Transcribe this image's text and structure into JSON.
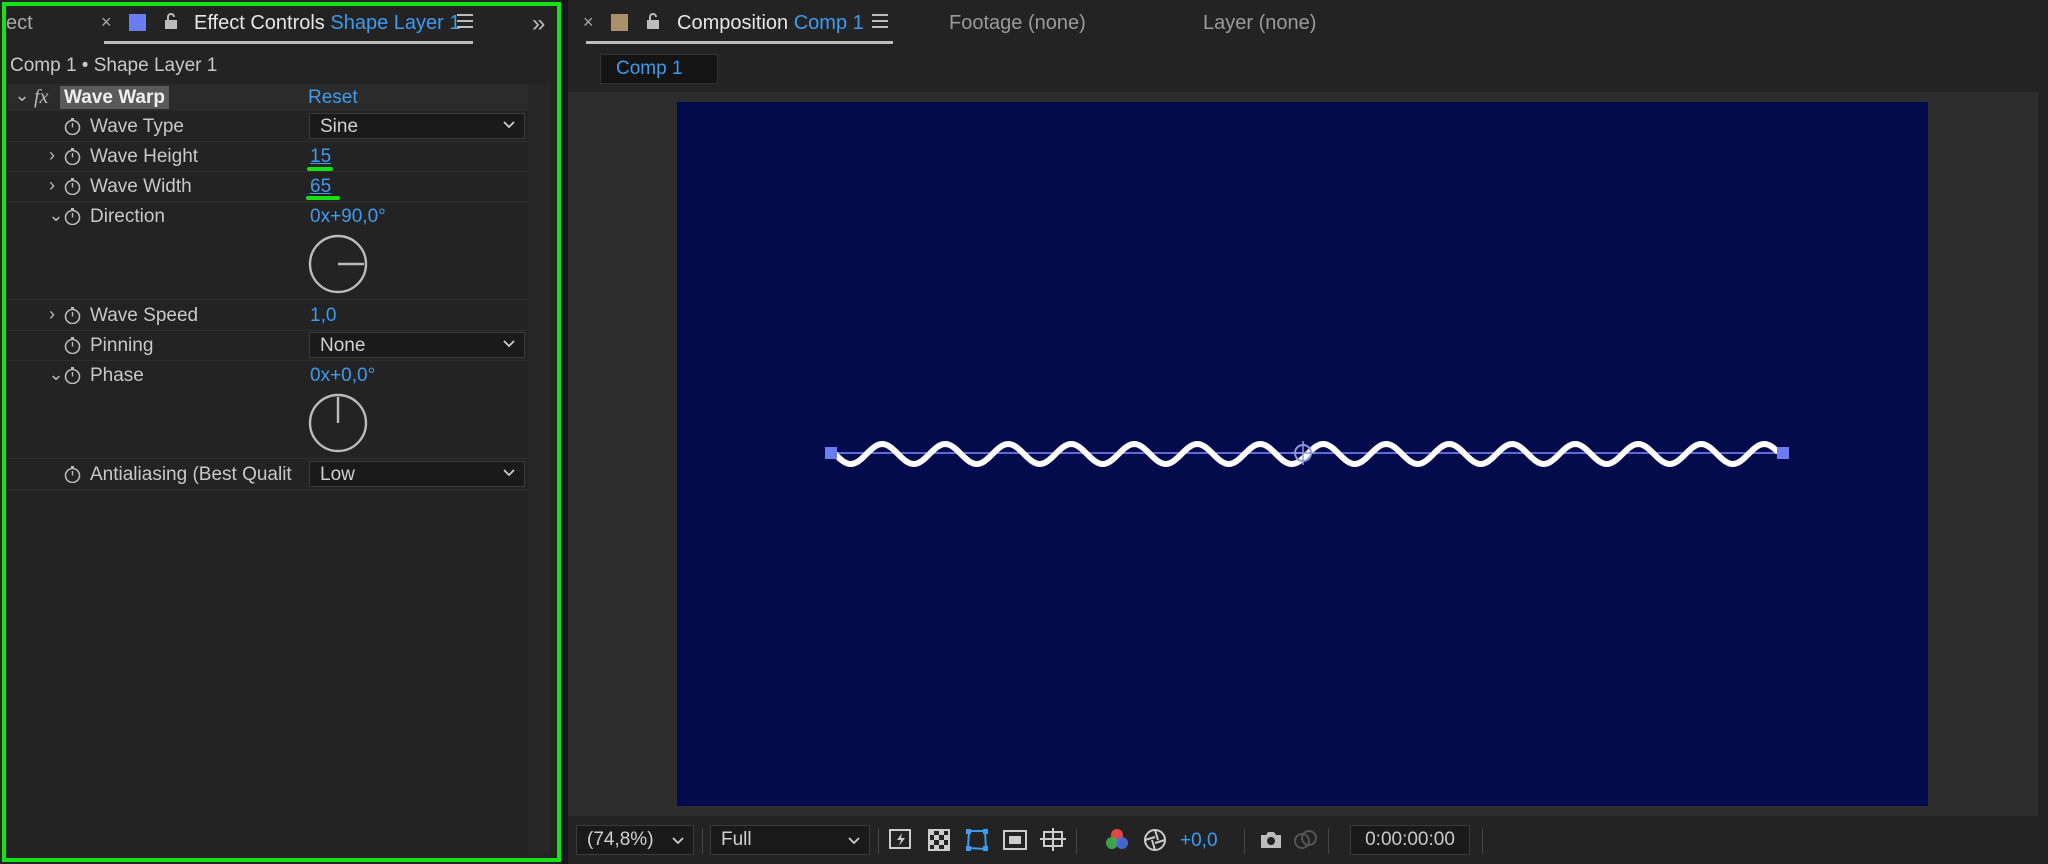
{
  "left_panel": {
    "prev_tab_label": "ect",
    "tab_prefix": "Effect Controls",
    "tab_layer": "Shape Layer 1",
    "breadcrumb": "Comp 1 • Shape Layer 1",
    "fx_symbol": "fx",
    "effect_name": "Wave Warp",
    "reset_label": "Reset",
    "properties": {
      "wave_type": {
        "label": "Wave Type",
        "value": "Sine"
      },
      "wave_height": {
        "label": "Wave Height",
        "value": "15"
      },
      "wave_width": {
        "label": "Wave Width",
        "value": "65"
      },
      "direction": {
        "label": "Direction",
        "revolutions": "0x",
        "angle": "+90,0°"
      },
      "wave_speed": {
        "label": "Wave Speed",
        "value": "1,0"
      },
      "pinning": {
        "label": "Pinning",
        "value": "None"
      },
      "phase": {
        "label": "Phase",
        "revolutions": "0x",
        "angle": "+0,0°"
      },
      "antialiasing": {
        "label": "Antialiasing (Best Qualit",
        "value": "Low"
      }
    }
  },
  "right_panel": {
    "tabs": {
      "composition_prefix": "Composition",
      "composition_name": "Comp 1",
      "footage": "Footage (none)",
      "layer": "Layer (none)"
    },
    "subtab": "Comp 1",
    "bottom_bar": {
      "zoom": "(74,8%)",
      "resolution": "Full",
      "exposure": "+0,0",
      "timecode": "0:00:00:00"
    }
  },
  "colors": {
    "accent_blue": "#3d9bf0",
    "highlight_green": "#16e016",
    "canvas_bg": "#030b4d",
    "layer_swatch": "#6b7cf0",
    "comp_swatch": "#a8906a"
  }
}
